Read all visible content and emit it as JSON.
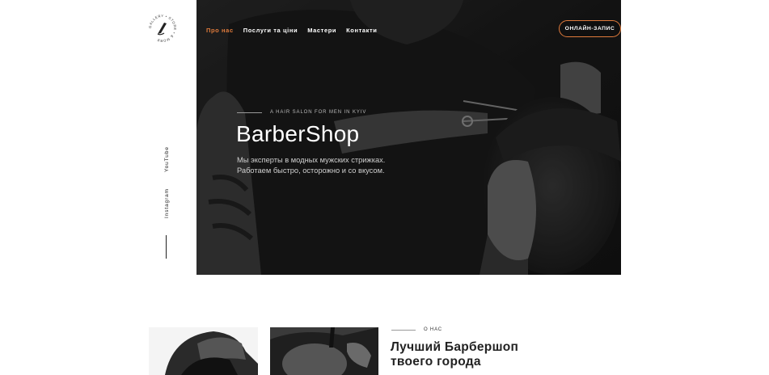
{
  "logo": {
    "text": "GALLERY • STORE • & MORE",
    "icon": "razor-icon"
  },
  "nav": {
    "items": [
      {
        "label": "Про нас",
        "active": true
      },
      {
        "label": "Послуги та ціни",
        "active": false
      },
      {
        "label": "Мастери",
        "active": false
      },
      {
        "label": "Контакти",
        "active": false
      }
    ],
    "cta_label": "ОНЛАЙН-ЗАПИС"
  },
  "hero": {
    "tagline": "A HAIR SALON FOR MEN IN KYIV",
    "title": "BarberShop",
    "description_line1": "Мы эксперты в модных мужских стрижках.",
    "description_line2": "Работаем быстро, осторожно и со вкусом."
  },
  "social": {
    "youtube": "YouTube",
    "instagram": "Instagram"
  },
  "about": {
    "label": "О НАС",
    "title_line1": "Лучший Барбершоп",
    "title_line2": "твоего города"
  },
  "colors": {
    "accent": "#e07b3c",
    "hero_bg": "#1e1e1e",
    "text": "#222222"
  }
}
